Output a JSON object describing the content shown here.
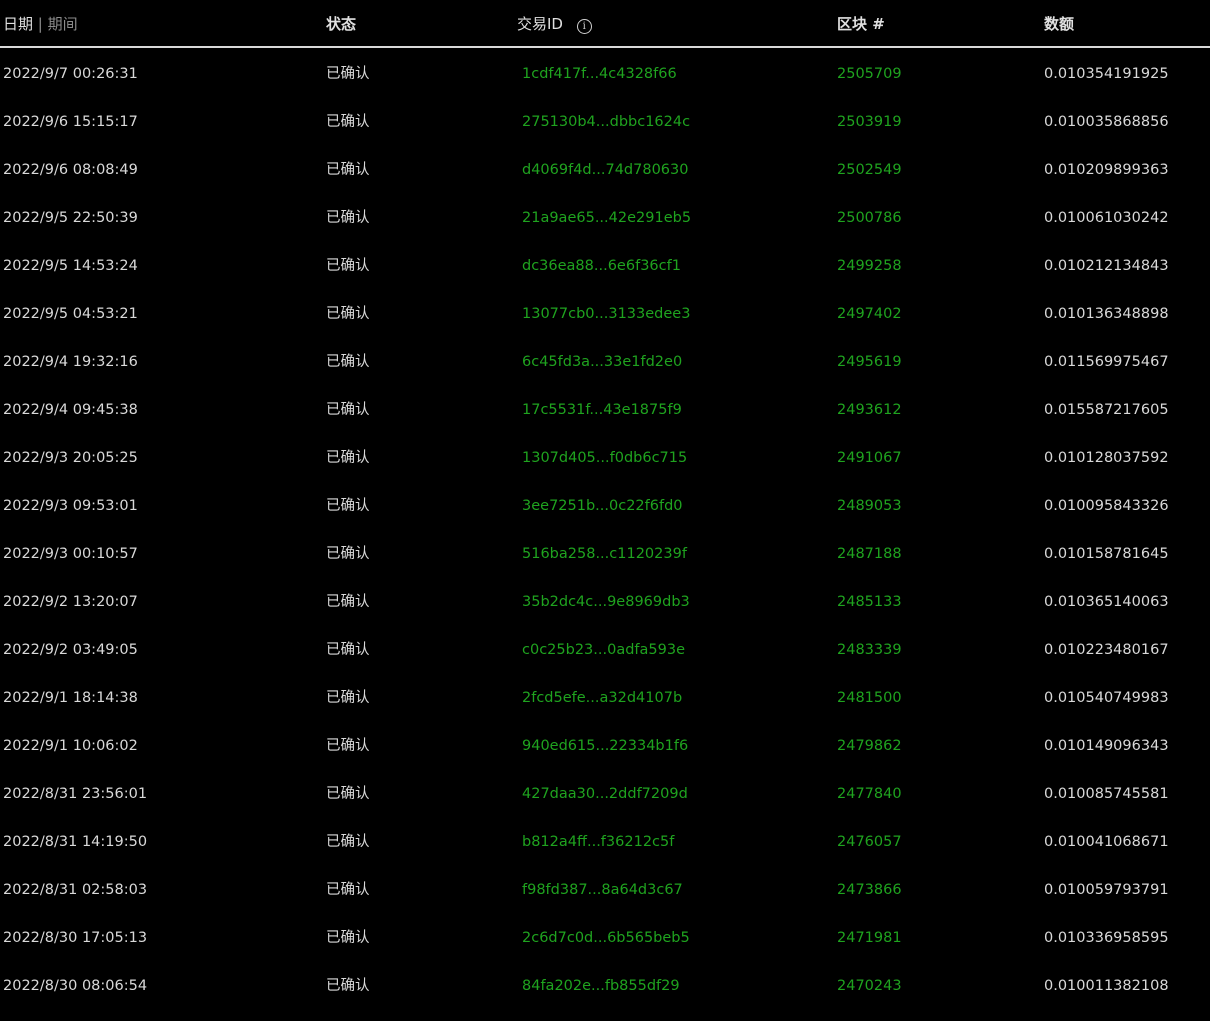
{
  "table": {
    "headers": {
      "date": "日期",
      "separator": "|",
      "period": "期间",
      "status": "状态",
      "txid": "交易ID",
      "info_glyph": "i",
      "block": "区块 #",
      "amount": "数额"
    },
    "link_color": "#1fa31f",
    "rows": [
      {
        "date": "2022/9/7 00:26:31",
        "status": "已确认",
        "txid": "1cdf417f...4c4328f66",
        "block": "2505709",
        "amount": "0.010354191925"
      },
      {
        "date": "2022/9/6 15:15:17",
        "status": "已确认",
        "txid": "275130b4...dbbc1624c",
        "block": "2503919",
        "amount": "0.010035868856"
      },
      {
        "date": "2022/9/6 08:08:49",
        "status": "已确认",
        "txid": "d4069f4d...74d780630",
        "block": "2502549",
        "amount": "0.010209899363"
      },
      {
        "date": "2022/9/5 22:50:39",
        "status": "已确认",
        "txid": "21a9ae65...42e291eb5",
        "block": "2500786",
        "amount": "0.010061030242"
      },
      {
        "date": "2022/9/5 14:53:24",
        "status": "已确认",
        "txid": "dc36ea88...6e6f36cf1",
        "block": "2499258",
        "amount": "0.010212134843"
      },
      {
        "date": "2022/9/5 04:53:21",
        "status": "已确认",
        "txid": "13077cb0...3133edee3",
        "block": "2497402",
        "amount": "0.010136348898"
      },
      {
        "date": "2022/9/4 19:32:16",
        "status": "已确认",
        "txid": "6c45fd3a...33e1fd2e0",
        "block": "2495619",
        "amount": "0.011569975467"
      },
      {
        "date": "2022/9/4 09:45:38",
        "status": "已确认",
        "txid": "17c5531f...43e1875f9",
        "block": "2493612",
        "amount": "0.015587217605"
      },
      {
        "date": "2022/9/3 20:05:25",
        "status": "已确认",
        "txid": "1307d405...f0db6c715",
        "block": "2491067",
        "amount": "0.010128037592"
      },
      {
        "date": "2022/9/3 09:53:01",
        "status": "已确认",
        "txid": "3ee7251b...0c22f6fd0",
        "block": "2489053",
        "amount": "0.010095843326"
      },
      {
        "date": "2022/9/3 00:10:57",
        "status": "已确认",
        "txid": "516ba258...c1120239f",
        "block": "2487188",
        "amount": "0.010158781645"
      },
      {
        "date": "2022/9/2 13:20:07",
        "status": "已确认",
        "txid": "35b2dc4c...9e8969db3",
        "block": "2485133",
        "amount": "0.010365140063"
      },
      {
        "date": "2022/9/2 03:49:05",
        "status": "已确认",
        "txid": "c0c25b23...0adfa593e",
        "block": "2483339",
        "amount": "0.010223480167"
      },
      {
        "date": "2022/9/1 18:14:38",
        "status": "已确认",
        "txid": "2fcd5efe...a32d4107b",
        "block": "2481500",
        "amount": "0.010540749983"
      },
      {
        "date": "2022/9/1 10:06:02",
        "status": "已确认",
        "txid": "940ed615...22334b1f6",
        "block": "2479862",
        "amount": "0.010149096343"
      },
      {
        "date": "2022/8/31 23:56:01",
        "status": "已确认",
        "txid": "427daa30...2ddf7209d",
        "block": "2477840",
        "amount": "0.010085745581"
      },
      {
        "date": "2022/8/31 14:19:50",
        "status": "已确认",
        "txid": "b812a4ff...f36212c5f",
        "block": "2476057",
        "amount": "0.010041068671"
      },
      {
        "date": "2022/8/31 02:58:03",
        "status": "已确认",
        "txid": "f98fd387...8a64d3c67",
        "block": "2473866",
        "amount": "0.010059793791"
      },
      {
        "date": "2022/8/30 17:05:13",
        "status": "已确认",
        "txid": "2c6d7c0d...6b565beb5",
        "block": "2471981",
        "amount": "0.010336958595"
      },
      {
        "date": "2022/8/30 08:06:54",
        "status": "已确认",
        "txid": "84fa202e...fb855df29",
        "block": "2470243",
        "amount": "0.010011382108"
      }
    ]
  }
}
